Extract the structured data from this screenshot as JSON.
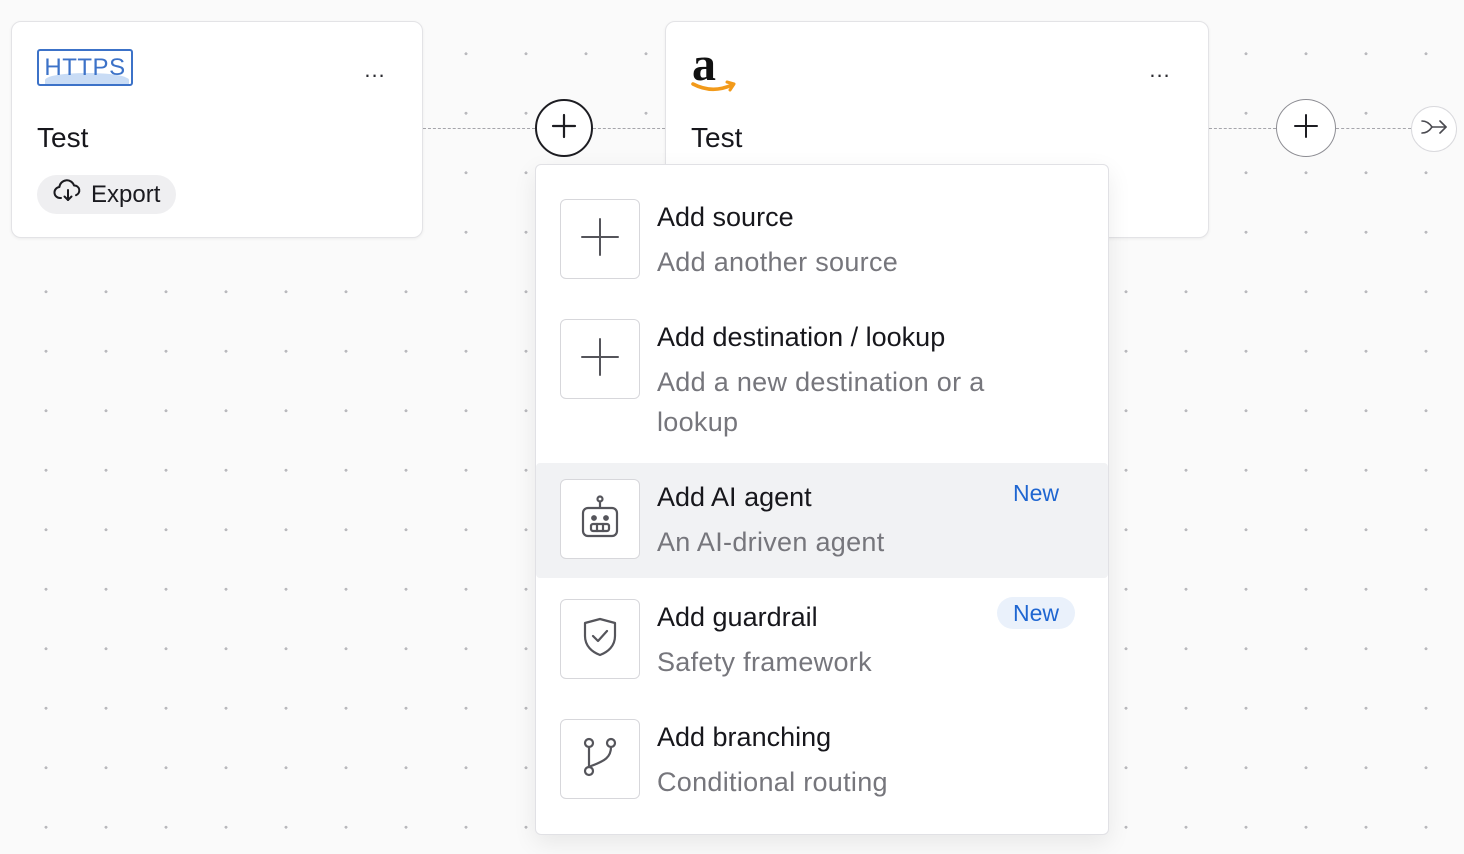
{
  "nodes": [
    {
      "logo_text": "HTTPS",
      "title": "Test",
      "more_label": "...",
      "action_label": "Export"
    },
    {
      "logo": "amazon-logo",
      "title": "Test",
      "more_label": "..."
    }
  ],
  "menu": {
    "items": [
      {
        "title": "Add source",
        "description": "Add another source",
        "icon": "plus-icon",
        "badge": ""
      },
      {
        "title": "Add destination / lookup",
        "description": "Add a new destination or a lookup",
        "icon": "plus-icon",
        "badge": ""
      },
      {
        "title": "Add AI agent",
        "description": "An AI-driven agent",
        "icon": "robot-icon",
        "badge": "New"
      },
      {
        "title": "Add guardrail",
        "description": "Safety framework",
        "icon": "shield-check-icon",
        "badge": "New"
      },
      {
        "title": "Add branching",
        "description": "Conditional routing",
        "icon": "branch-icon",
        "badge": ""
      }
    ]
  },
  "colors": {
    "accent_blue": "#1f66d1",
    "https_blue": "#3c72c8",
    "amazon_orange": "#f29a1a",
    "hover_bg": "#f1f2f4"
  }
}
